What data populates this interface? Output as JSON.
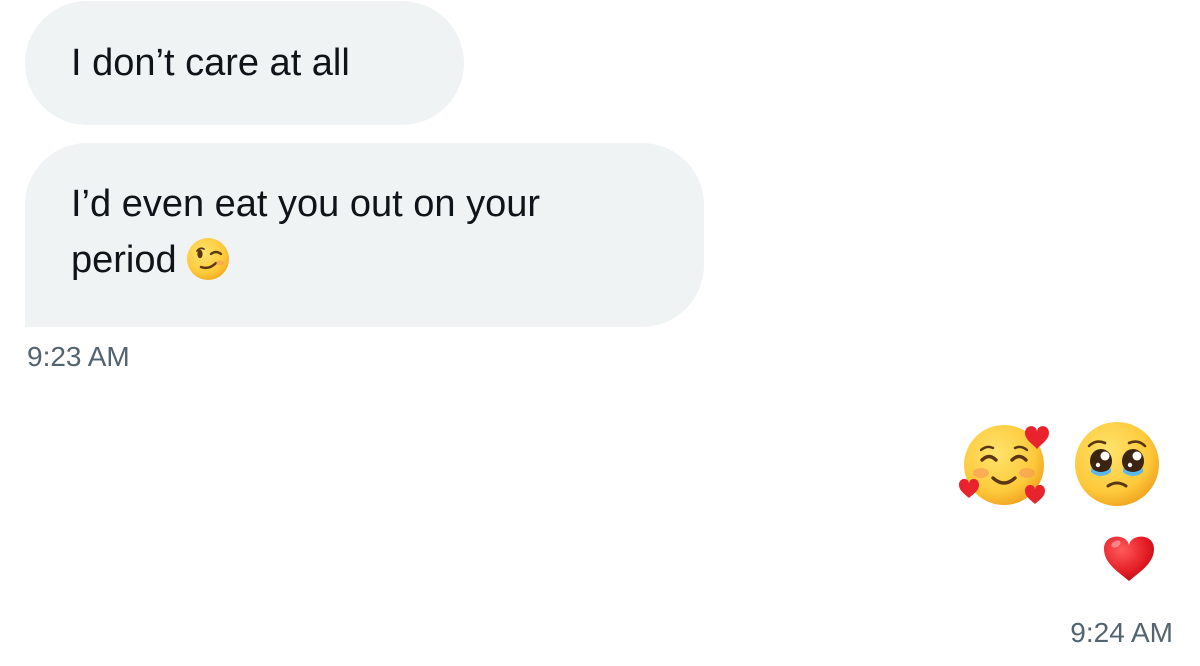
{
  "conversation": {
    "received": {
      "messages": [
        {
          "lines": [
            "I don’t care at all"
          ]
        },
        {
          "lines": [
            "I’d even eat you out on your",
            "period"
          ],
          "trailing_emoji": "winking-face-emoji"
        }
      ],
      "timestamp": "9:23 AM"
    },
    "sent": {
      "emoji_row": [
        "smiling-face-with-hearts-emoji",
        "pleading-face-emoji"
      ],
      "second_row": [
        "red-heart-emoji"
      ],
      "timestamp": "9:24 AM"
    }
  },
  "colors": {
    "received_bubble": "#eff3f4",
    "message_text": "#0f1419",
    "timestamp_text": "#536471",
    "background": "#ffffff"
  }
}
